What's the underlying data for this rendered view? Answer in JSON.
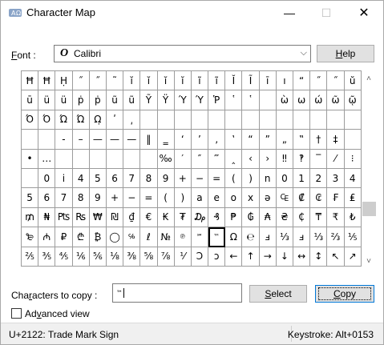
{
  "window": {
    "title": "Character Map",
    "min_glyph": "—",
    "max_glyph": "☐",
    "close_glyph": "✕"
  },
  "font": {
    "label_mnemonic": "F",
    "label_rest": "ont :",
    "icon_glyph": "O",
    "value": "Calibri",
    "dropdown_glyph": "⌵"
  },
  "help_button": {
    "mnemonic": "H",
    "rest": "elp"
  },
  "grid": {
    "rows": [
      [
        "Ħ",
        "Ħ",
        "Ḥ",
        "˝",
        "˝",
        "˜",
        "ĭ",
        "ĭ",
        "ĭ",
        "ĭ",
        "ĩ",
        "ĩ",
        "Ĭ",
        "Ĩ",
        "ī",
        "ı",
        "“",
        "˝",
        "˝",
        "ŭ"
      ],
      [
        "ū",
        "ü",
        "ü",
        "ṗ",
        "ṗ",
        "ũ",
        "ũ",
        "Ỹ",
        "Ÿ",
        "Ύ",
        "Ύ",
        "Ῥ",
        "῾",
        "῾",
        "",
        "ὼ",
        "ω",
        "ώ",
        "ῶ",
        "ῷ"
      ],
      [
        "Ό",
        "Ό",
        "Ώ",
        "Ώ",
        "Ω̣",
        "ʹ",
        "͵",
        "",
        "",
        "",
        "",
        "",
        "",
        "",
        "",
        "",
        "",
        "",
        "",
        ""
      ],
      [
        "",
        "",
        "-",
        "–",
        "—",
        "—",
        "—",
        "‖",
        "‗",
        "‘",
        "’",
        "‚",
        "‛",
        "“",
        "”",
        "„",
        "‟",
        "†",
        "‡",
        ""
      ],
      [
        "•",
        "…",
        "",
        "",
        "",
        "",
        "",
        "",
        "‰",
        "′",
        "″",
        "‴",
        "‸",
        "‹",
        "›",
        "‼",
        "‽",
        "‾",
        "⁄",
        "⁝"
      ],
      [
        "",
        "0",
        "i",
        "4",
        "5",
        "6",
        "7",
        "8",
        "9",
        "+",
        "−",
        "=",
        "(",
        ")",
        "n",
        "0",
        "1",
        "2",
        "3",
        "4"
      ],
      [
        "5",
        "6",
        "7",
        "8",
        "9",
        "+",
        "−",
        "=",
        "(",
        ")",
        "a",
        "e",
        "o",
        "x",
        "ə",
        "₠",
        "₡",
        "₢",
        "₣",
        "₤"
      ],
      [
        "₥",
        "₦",
        "₧",
        "₨",
        "₩",
        "₪",
        "₫",
        "€",
        "₭",
        "₮",
        "₯",
        "₰",
        "₱",
        "₲",
        "₳",
        "₴",
        "₵",
        "₸",
        "₹",
        "₺"
      ],
      [
        "₻",
        "₼",
        "₽",
        "₾",
        "₿",
        "◯",
        "℅",
        "ℓ",
        "№",
        "℗",
        "℠",
        "™",
        "Ω",
        "℮",
        "ⅎ",
        "⅓",
        "ⅎ",
        "⅓",
        "⅔",
        "⅕"
      ],
      [
        "⅖",
        "⅗",
        "⅘",
        "⅙",
        "⅚",
        "⅛",
        "⅜",
        "⅝",
        "⅞",
        "⅟",
        "Ↄ",
        "ↄ",
        "←",
        "↑",
        "→",
        "↓",
        "↔",
        "↕",
        "↖",
        "↗"
      ]
    ],
    "selected_char": "™"
  },
  "copy_row": {
    "label_pre": "Cha",
    "label_mnemonic": "r",
    "label_post": "acters to copy :",
    "value": "™"
  },
  "select_button": {
    "mnemonic": "S",
    "rest": "elect"
  },
  "copy_button": {
    "mnemonic": "C",
    "rest": "opy"
  },
  "advanced": {
    "pre": "Ad",
    "mnemonic": "v",
    "post": "anced view",
    "checked": false
  },
  "status": {
    "left": "U+2122: Trade Mark Sign",
    "right": "Keystroke: Alt+0153"
  },
  "scrollbar": {
    "up_glyph": "˄",
    "down_glyph": "˅",
    "thumb_position": 0.66
  },
  "colors": {
    "accent": "#0078d7",
    "button_bg": "#e1e1e1",
    "statusbar_bg": "#f0f0f0",
    "grid_line": "#9c9c9c"
  }
}
